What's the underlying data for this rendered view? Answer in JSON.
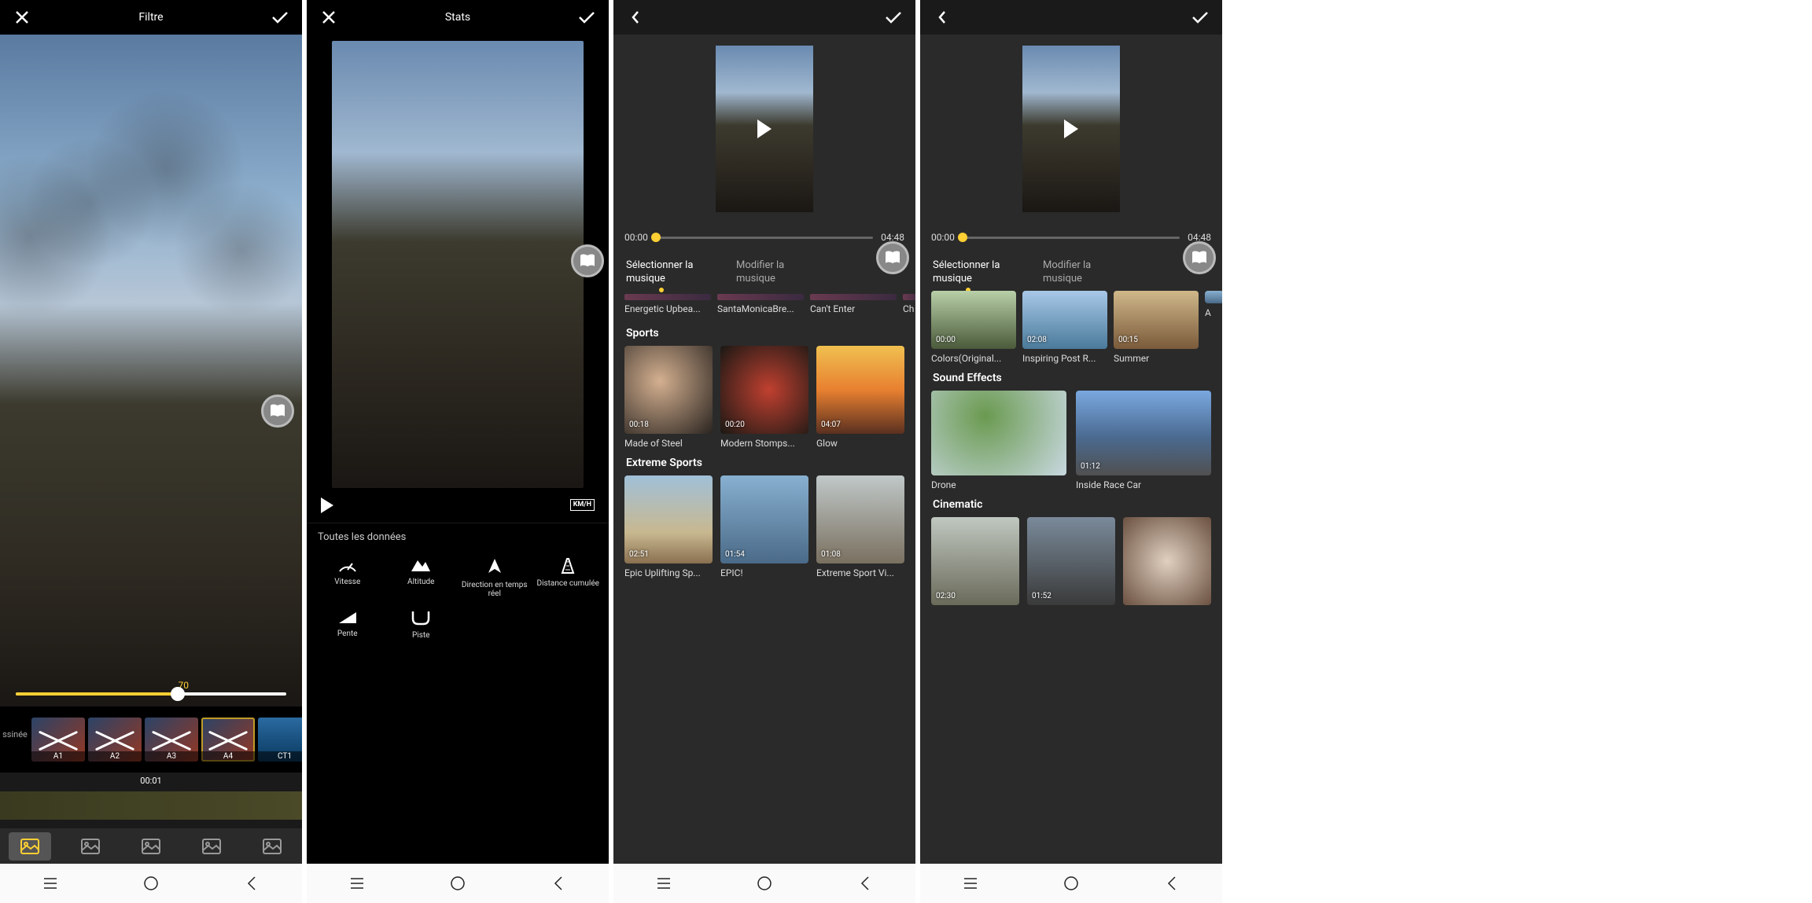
{
  "screen1": {
    "title": "Filtre",
    "slider_value": "70",
    "filters": [
      {
        "id": "dessinee",
        "label": "ssinée"
      },
      {
        "id": "a1",
        "label": "A1"
      },
      {
        "id": "a2",
        "label": "A2"
      },
      {
        "id": "a3",
        "label": "A3"
      },
      {
        "id": "a4",
        "label": "A4",
        "selected": true
      },
      {
        "id": "ct1",
        "label": "CT1"
      }
    ],
    "timeline_time": "00:01"
  },
  "screen2": {
    "title": "Stats",
    "km_label": "KM/H",
    "all_data": "Toutes les données",
    "stats": [
      {
        "id": "vitesse",
        "label": "Vitesse"
      },
      {
        "id": "altitude",
        "label": "Altitude"
      },
      {
        "id": "direction",
        "label": "Direction en temps réel"
      },
      {
        "id": "distance",
        "label": "Distance cumulée"
      },
      {
        "id": "pente",
        "label": "Pente"
      },
      {
        "id": "piste",
        "label": "Piste"
      }
    ]
  },
  "screen3": {
    "time_start": "00:00",
    "time_end": "04:48",
    "tab_select": "Sélectionner la musique",
    "tab_modify": "Modifier la musique",
    "top_row": [
      {
        "dur": "",
        "label": "Energetic Upbea..."
      },
      {
        "dur": "",
        "label": "SantaMonicaBre..."
      },
      {
        "dur": "",
        "label": "Can't Enter"
      },
      {
        "dur": "",
        "label": "Ch"
      }
    ],
    "section1": "Sports",
    "sports": [
      {
        "dur": "00:18",
        "label": "Made of Steel",
        "bg": "bg-gym1"
      },
      {
        "dur": "00:20",
        "label": "Modern Stomps...",
        "bg": "bg-gym2"
      },
      {
        "dur": "04:07",
        "label": "Glow",
        "bg": "bg-sunset"
      }
    ],
    "section2": "Extreme Sports",
    "extreme": [
      {
        "dur": "02:51",
        "label": "Epic Uplifting Sp...",
        "bg": "bg-beach"
      },
      {
        "dur": "01:54",
        "label": "EPIC!",
        "bg": "bg-sky1"
      },
      {
        "dur": "01:08",
        "label": "Extreme Sport Vi...",
        "bg": "bg-climb"
      }
    ]
  },
  "screen4": {
    "time_start": "00:00",
    "time_end": "04:48",
    "tab_select": "Sélectionner la musique",
    "tab_modify": "Modifier la musique",
    "top_row": [
      {
        "dur": "00:00",
        "label": "Colors(Original...",
        "bg": "bg-tree"
      },
      {
        "dur": "02:08",
        "label": "Inspiring Post R...",
        "bg": "bg-sea"
      },
      {
        "dur": "00:15",
        "label": "Summer",
        "bg": "bg-warm"
      },
      {
        "dur": "",
        "label": "A",
        "bg": "bg-sky1"
      }
    ],
    "section1": "Sound Effects",
    "sfx": [
      {
        "dur": "",
        "label": "Drone",
        "bg": "bg-green"
      },
      {
        "dur": "01:12",
        "label": "Inside Race Car",
        "bg": "bg-road"
      }
    ],
    "section2": "Cinematic",
    "cine": [
      {
        "dur": "02:30",
        "label": "",
        "bg": "bg-pier"
      },
      {
        "dur": "01:52",
        "label": "",
        "bg": "bg-city"
      },
      {
        "dur": "",
        "label": "",
        "bg": "bg-tunnel"
      }
    ]
  }
}
